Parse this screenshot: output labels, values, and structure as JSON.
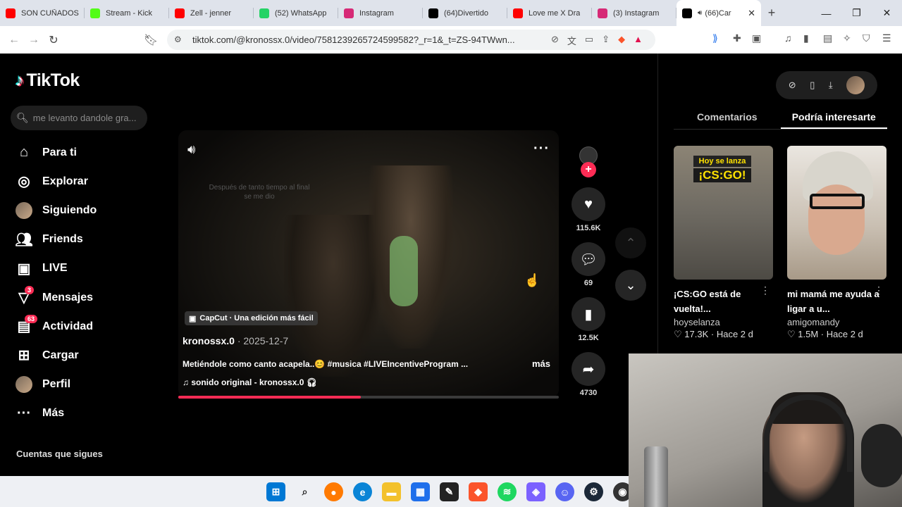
{
  "browser": {
    "tabs": [
      {
        "title": "SON CUÑADOS",
        "fav_color": "#ff0000",
        "active": false
      },
      {
        "title": "Stream - Kick",
        "fav_color": "#53fc18",
        "active": false
      },
      {
        "title": "Zell - jenner",
        "fav_color": "#ff0000",
        "active": false
      },
      {
        "title": "(52) WhatsApp",
        "fav_color": "#25d366",
        "active": false
      },
      {
        "title": "Instagram",
        "fav_color": "#d62976",
        "active": false
      },
      {
        "title": "(64)Divertido",
        "fav_color": "#000000",
        "active": false
      },
      {
        "title": "Love me X Dra",
        "fav_color": "#ff0000",
        "active": false
      },
      {
        "title": "(3) Instagram",
        "fav_color": "#d62976",
        "active": false
      },
      {
        "title": "(66)Car",
        "fav_color": "#000000",
        "active": true
      }
    ],
    "url": "tiktok.com/@kronossx.0/video/7581239265724599582?_r=1&_t=ZS-94TWwn..."
  },
  "tiktok": {
    "brand": "TikTok",
    "search_placeholder": "me levanto dandole gra...",
    "nav": [
      {
        "label": "Para ti",
        "icon": "home-icon"
      },
      {
        "label": "Explorar",
        "icon": "compass-icon"
      },
      {
        "label": "Siguiendo",
        "icon": "following-avatar-icon"
      },
      {
        "label": "Friends",
        "icon": "friends-icon"
      },
      {
        "label": "LIVE",
        "icon": "live-icon"
      },
      {
        "label": "Mensajes",
        "icon": "messages-icon",
        "badge": "3"
      },
      {
        "label": "Actividad",
        "icon": "activity-icon",
        "badge": "63"
      },
      {
        "label": "Cargar",
        "icon": "upload-icon"
      },
      {
        "label": "Perfil",
        "icon": "profile-avatar-icon"
      },
      {
        "label": "Más",
        "icon": "more-icon"
      }
    ],
    "following_header": "Cuentas que sigues"
  },
  "video": {
    "subtitle": "Después de tanto tiempo al final se me dio",
    "capcut_label": "CapCut · Una edición más fácil",
    "author": "kronossx.0",
    "date": "· 2025-12-7",
    "caption": "Metiéndole como canto acapela..😊 #musica #LIVEIncentiveProgram ...",
    "more_label": "más",
    "music": "sonido original - kronossx.0",
    "progress": 0.48,
    "likes": "115.6K",
    "comments": "69",
    "saves": "12.5K",
    "shares": "4730"
  },
  "right_panel": {
    "tabs": [
      "Comentarios",
      "Podría interesarte"
    ],
    "selected_tab": 1,
    "cards": [
      {
        "thumb_top": "Hoy se lanza",
        "thumb_big": "¡CS:GO!",
        "title": "¡CS:GO está de vuelta!...",
        "author": "hoyselanza",
        "likes": "17.3K",
        "age": "Hace 2 d"
      },
      {
        "title": "mi mamá me ayuda a ligar a u...",
        "author": "amigomandy",
        "likes": "1.5M",
        "age": "Hace 2 d"
      }
    ]
  }
}
